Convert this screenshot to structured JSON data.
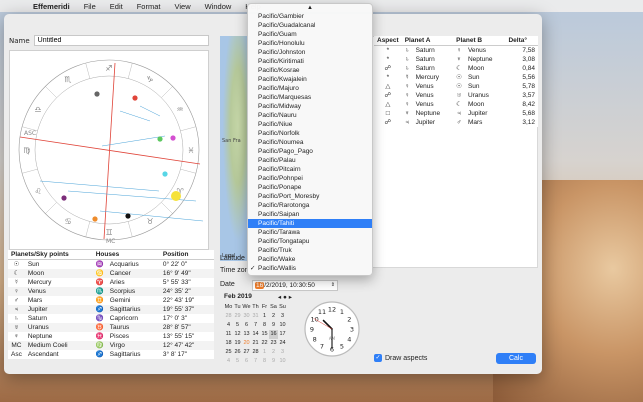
{
  "menubar": {
    "app": "Effemeridi",
    "items": [
      "File",
      "Edit",
      "Format",
      "View",
      "Window",
      "Help"
    ]
  },
  "name": {
    "label": "Name",
    "value": "Untitled"
  },
  "planets_table": {
    "headers": [
      "Planets/Sky points",
      "Houses",
      "Position"
    ],
    "rows": [
      {
        "glyph": "☉",
        "name": "Sun",
        "hglyph": "♒",
        "house": "Acquarius",
        "pos": "0° 22' 0\""
      },
      {
        "glyph": "☾",
        "name": "Moon",
        "hglyph": "♋",
        "house": "Cancer",
        "pos": "16° 9' 49\""
      },
      {
        "glyph": "☿",
        "name": "Mercury",
        "hglyph": "♈",
        "house": "Aries",
        "pos": "5° 55' 33\""
      },
      {
        "glyph": "♀",
        "name": "Venus",
        "hglyph": "♏",
        "house": "Scorpius",
        "pos": "24° 35' 2\""
      },
      {
        "glyph": "♂",
        "name": "Mars",
        "hglyph": "♊",
        "house": "Gemini",
        "pos": "22° 43' 19\""
      },
      {
        "glyph": "♃",
        "name": "Jupiter",
        "hglyph": "♐",
        "house": "Sagittarius",
        "pos": "19° 55' 37\""
      },
      {
        "glyph": "♄",
        "name": "Saturn",
        "hglyph": "♑",
        "house": "Capricorn",
        "pos": "17° 0' 3\""
      },
      {
        "glyph": "♅",
        "name": "Uranus",
        "hglyph": "♉",
        "house": "Taurus",
        "pos": "28° 8' 57\""
      },
      {
        "glyph": "♆",
        "name": "Neptune",
        "hglyph": "♓",
        "house": "Pisces",
        "pos": "13° 55' 15\""
      },
      {
        "glyph": "MC",
        "name": "Medium Coeli",
        "hglyph": "♍",
        "house": "Virgo",
        "pos": "12° 47' 42\""
      },
      {
        "glyph": "Asc",
        "name": "Ascendant",
        "hglyph": "♐",
        "house": "Sagittarius",
        "pos": "3° 8' 17\""
      }
    ]
  },
  "map": {
    "city": "San Fra",
    "legal": "Legal"
  },
  "labels": {
    "latitude": "Latitude",
    "timezone": "Time zon",
    "date": "Date"
  },
  "date_field": {
    "day": "16",
    "rest": "/2/2019, 10:30:50"
  },
  "calendar": {
    "month": "Feb 2019",
    "nav": "◂ ● ▸",
    "weekdays": [
      "Mo",
      "Tu",
      "We",
      "Th",
      "Fr",
      "Sa",
      "Su"
    ],
    "days": [
      "28",
      "29",
      "30",
      "31",
      "1",
      "2",
      "3",
      "4",
      "5",
      "6",
      "7",
      "8",
      "9",
      "10",
      "11",
      "12",
      "13",
      "14",
      "15",
      "16",
      "17",
      "18",
      "19",
      "20",
      "21",
      "22",
      "23",
      "24",
      "25",
      "26",
      "27",
      "28",
      "1",
      "2",
      "3",
      "4",
      "5",
      "6",
      "7",
      "8",
      "9",
      "10"
    ]
  },
  "clock": {
    "numbers": [
      "12",
      "1",
      "2",
      "3",
      "4",
      "5",
      "6",
      "7",
      "8",
      "9",
      "10",
      "11"
    ],
    "am_pm": "AM",
    "hour": 10,
    "minute": 30,
    "second": 50
  },
  "timezone_menu": {
    "items": [
      "Pacific/Gambier",
      "Pacific/Guadalcanal",
      "Pacific/Guam",
      "Pacific/Honolulu",
      "Pacific/Johnston",
      "Pacific/Kiritimati",
      "Pacific/Kosrae",
      "Pacific/Kwajalein",
      "Pacific/Majuro",
      "Pacific/Marquesas",
      "Pacific/Midway",
      "Pacific/Nauru",
      "Pacific/Niue",
      "Pacific/Norfolk",
      "Pacific/Noumea",
      "Pacific/Pago_Pago",
      "Pacific/Palau",
      "Pacific/Pitcairn",
      "Pacific/Pohnpei",
      "Pacific/Ponape",
      "Pacific/Port_Moresby",
      "Pacific/Rarotonga",
      "Pacific/Saipan",
      "Pacific/Tahiti",
      "Pacific/Tarawa",
      "Pacific/Tongatapu",
      "Pacific/Truk",
      "Pacific/Wake",
      "Pacific/Wallis"
    ],
    "selected": "Pacific/Tahiti",
    "checked": "Pacific/Wallis",
    "scroll_arrow": "▲"
  },
  "aspects_table": {
    "headers": [
      "Aspect",
      "Planet A",
      "Planet B",
      "Delta°"
    ],
    "rows": [
      {
        "aspect": "*",
        "ga": "♄",
        "a": "Saturn",
        "gb": "♀",
        "b": "Venus",
        "d": "7,58"
      },
      {
        "aspect": "*",
        "ga": "♄",
        "a": "Saturn",
        "gb": "♆",
        "b": "Neptune",
        "d": "3,08"
      },
      {
        "aspect": "☍",
        "ga": "♄",
        "a": "Saturn",
        "gb": "☾",
        "b": "Moon",
        "d": "0,84"
      },
      {
        "aspect": "*",
        "ga": "☿",
        "a": "Mercury",
        "gb": "☉",
        "b": "Sun",
        "d": "5,56"
      },
      {
        "aspect": "△",
        "ga": "♀",
        "a": "Venus",
        "gb": "☉",
        "b": "Sun",
        "d": "5,78"
      },
      {
        "aspect": "☍",
        "ga": "♀",
        "a": "Venus",
        "gb": "♅",
        "b": "Uranus",
        "d": "3,57"
      },
      {
        "aspect": "△",
        "ga": "♀",
        "a": "Venus",
        "gb": "☾",
        "b": "Moon",
        "d": "8,42"
      },
      {
        "aspect": "□",
        "ga": "♆",
        "a": "Neptune",
        "gb": "♃",
        "b": "Jupiter",
        "d": "5,68"
      },
      {
        "aspect": "☍",
        "ga": "♃",
        "a": "Jupiter",
        "gb": "♂",
        "b": "Mars",
        "d": "3,12"
      }
    ]
  },
  "draw_aspects": {
    "label": "Draw aspects",
    "checked": true
  },
  "calc_button": "Calc",
  "zodiac_glyphs": [
    "♈",
    "♉",
    "♊",
    "♋",
    "♌",
    "♍",
    "♎",
    "♏",
    "♐",
    "♑",
    "♒",
    "♓"
  ],
  "axis_labels": {
    "asc": "ASC",
    "mc": "MC"
  },
  "colors": {
    "accent": "#2f7ff7",
    "highlight": "#ef7d2a"
  }
}
